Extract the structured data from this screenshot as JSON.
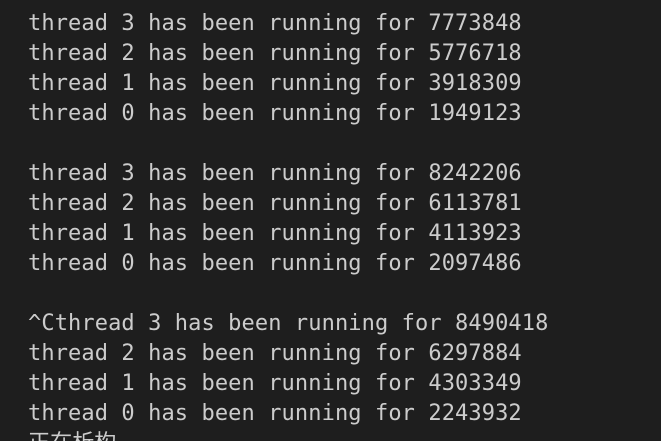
{
  "terminal": {
    "lines": [
      "thread 3 has been running for 7773848",
      "thread 2 has been running for 5776718",
      "thread 1 has been running for 3918309",
      "thread 0 has been running for 1949123",
      "",
      "thread 3 has been running for 8242206",
      "thread 2 has been running for 6113781",
      "thread 1 has been running for 4113923",
      "thread 0 has been running for 2097486",
      "",
      "^Cthread 3 has been running for 8490418",
      "thread 2 has been running for 6297884",
      "thread 1 has been running for 4303349",
      "thread 0 has been running for 2243932",
      "正在析构"
    ]
  }
}
